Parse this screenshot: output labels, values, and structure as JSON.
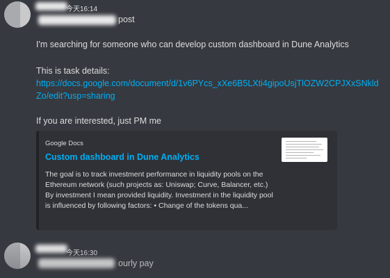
{
  "message1": {
    "timestamp": "今天16:14",
    "header_suffix": "post",
    "text": "I'm searching for someone who can develop custom dashboard in Dune Analytics",
    "task_label": "This is task details:",
    "link": "https://docs.google.com/document/d/1v6PYcs_xXe6B5LXti4gipoUsjTlOZW2CPJXxSNkldZo/edit?usp=sharing",
    "closing": "If you are interested, just PM me",
    "embed": {
      "provider": "Google Docs",
      "title": "Custom dashboard in Dune Analytics",
      "description": "The goal is to track investment performance in liquidity pools on the Ethereum network (such projects as: Uniswap; Curve, Balancer, etc.) By investment I mean provided liquidity. Investment in the liquidity pool is influenced by following factors: • Change of the tokens qua..."
    }
  },
  "message2": {
    "timestamp": "今天16:30",
    "text": "ourly pay"
  }
}
